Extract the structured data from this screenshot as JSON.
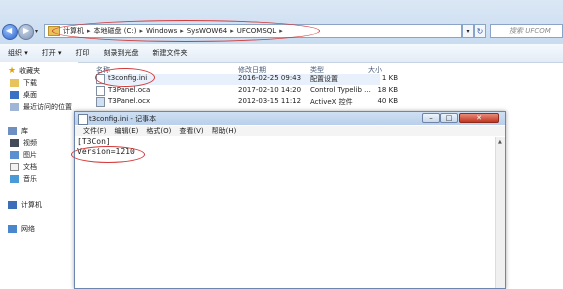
{
  "address": {
    "crumbs": [
      "计算机",
      "本地磁盘 (C:)",
      "Windows",
      "SysWOW64",
      "UFCOMSQL"
    ],
    "separator": "▸",
    "dropdown_glyph": "▾",
    "refresh_glyph": "↻"
  },
  "nav": {
    "back_glyph": "◀",
    "forward_glyph": "▶",
    "dropdown_glyph": "▾"
  },
  "search": {
    "placeholder": "搜索 UFCOM"
  },
  "toolbar": {
    "organize": "组织 ▾",
    "open": "打开 ▾",
    "print": "打印",
    "burn": "刻录到光盘",
    "new_folder": "新建文件夹"
  },
  "sidebar": {
    "favorites": "收藏夹",
    "downloads": "下载",
    "desktop": "桌面",
    "recent": "最近访问的位置",
    "libraries": "库",
    "videos": "视频",
    "pictures": "图片",
    "documents": "文档",
    "music": "音乐",
    "computer": "计算机",
    "network": "网络"
  },
  "columns": {
    "name": "名称",
    "date": "修改日期",
    "type": "类型",
    "size": "大小"
  },
  "files": [
    {
      "name": "t3config.ini",
      "date": "2016-02-25 09:43",
      "type": "配置设置",
      "size": "1 KB"
    },
    {
      "name": "T3Panel.oca",
      "date": "2017-02-10 14:20",
      "type": "Control Typelib ...",
      "size": "18 KB"
    },
    {
      "name": "T3Panel.ocx",
      "date": "2012-03-15 11:12",
      "type": "ActiveX 控件",
      "size": "40 KB"
    }
  ],
  "notepad": {
    "title": "t3config.ini - 记事本",
    "menu": [
      "文件(F)",
      "编辑(E)",
      "格式(O)",
      "查看(V)",
      "帮助(H)"
    ],
    "line1": "[T3Con]",
    "line2": "Version=1210",
    "minimize_glyph": "–",
    "maximize_glyph": "□",
    "close_glyph": "✕",
    "scroll_up_glyph": "▲"
  },
  "colors": {
    "annotation": "#d33a3a",
    "titlebar": "#c9dcf0"
  }
}
